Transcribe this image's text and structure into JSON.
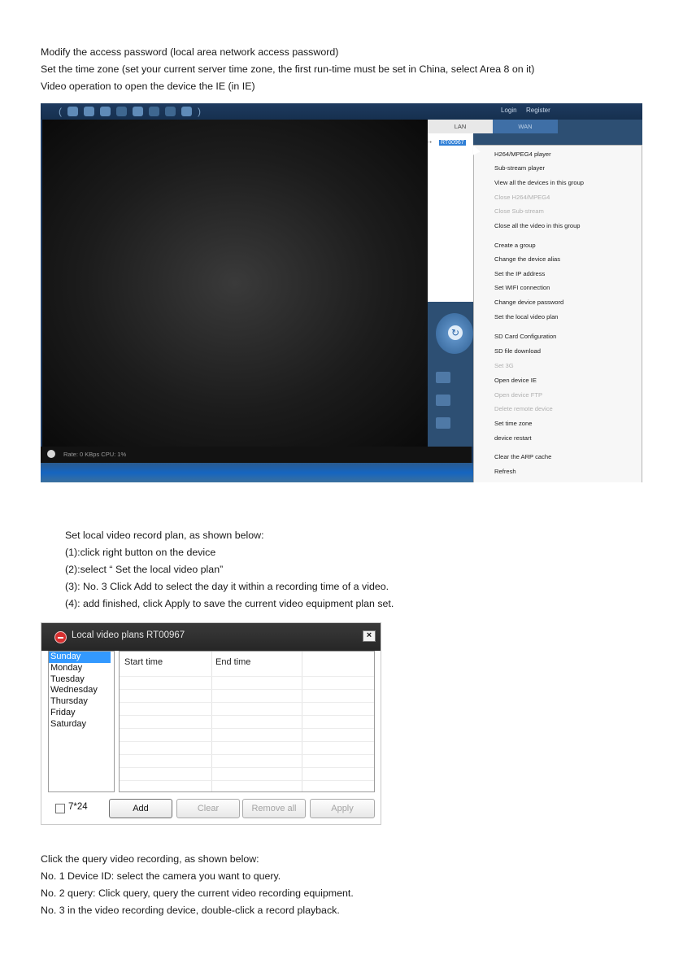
{
  "intro": {
    "line1": "Modify the access password (local area network access password)",
    "line2": "Set the time zone (set your current server time zone, the first run-time must be set in China, select Area 8 on it)",
    "line3": "Video operation to open the device the IE (in IE)"
  },
  "screenshot1": {
    "toplinks": {
      "login": "Login",
      "register": "Register"
    },
    "tabs": {
      "lan": "LAN",
      "wan": "WAN"
    },
    "device_node": "RT00967",
    "status": "Rate: 0 KBps  CPU: 1%",
    "context_menu": [
      {
        "label": "H264/MPEG4 player",
        "enabled": true
      },
      {
        "label": "Sub-stream player",
        "enabled": true
      },
      {
        "label": "View all the devices in this group",
        "enabled": true
      },
      {
        "label": "Close H264/MPEG4",
        "enabled": false
      },
      {
        "label": "Close Sub-stream",
        "enabled": false
      },
      {
        "label": "Close all the video in this group",
        "enabled": true
      },
      {
        "label": "Create a group",
        "enabled": true
      },
      {
        "label": "Change the device alias",
        "enabled": true
      },
      {
        "label": "Set the IP address",
        "enabled": true
      },
      {
        "label": "Set WIFI connection",
        "enabled": true
      },
      {
        "label": "Change device password",
        "enabled": true
      },
      {
        "label": "Set the local video plan",
        "enabled": true
      },
      {
        "label": "SD Card Configuration",
        "enabled": true
      },
      {
        "label": "SD file download",
        "enabled": true
      },
      {
        "label": "Set 3G",
        "enabled": false
      },
      {
        "label": "Open device IE",
        "enabled": true
      },
      {
        "label": "Open device FTP",
        "enabled": false
      },
      {
        "label": "Delete remote device",
        "enabled": false
      },
      {
        "label": "Set time zone",
        "enabled": true
      },
      {
        "label": "device restart",
        "enabled": true
      },
      {
        "label": "Clear the ARP cache",
        "enabled": true
      },
      {
        "label": "Refresh",
        "enabled": true
      }
    ]
  },
  "steps": {
    "heading": "Set local video record plan, as shown below:",
    "s1": "(1):click right button on the device",
    "s2": "(2):select “ Set the local video plan”",
    "s3": "(3): No. 3 Click Add to select the day it within a recording time of a video.",
    "s4": "(4): add finished, click Apply to save the current video equipment plan set."
  },
  "dialog": {
    "title": "Local video plans RT00967",
    "days": [
      "Sunday",
      "Monday",
      "Tuesday",
      "Wednesday",
      "Thursday",
      "Friday",
      "Saturday"
    ],
    "selected_day": "Sunday",
    "columns": {
      "start": "Start time",
      "end": "End time"
    },
    "checkbox_label": "7*24",
    "buttons": {
      "add": "Add",
      "clear": "Clear",
      "remove_all": "Remove all",
      "apply": "Apply"
    }
  },
  "query": {
    "heading": "Click the query video recording, as shown below:",
    "q1": "No. 1 Device ID: select the camera you want to query.",
    "q2": "No. 2 query: Click query, query the current video recording equipment.",
    "q3": "No. 3 in the video recording device, double-click a record playback."
  }
}
